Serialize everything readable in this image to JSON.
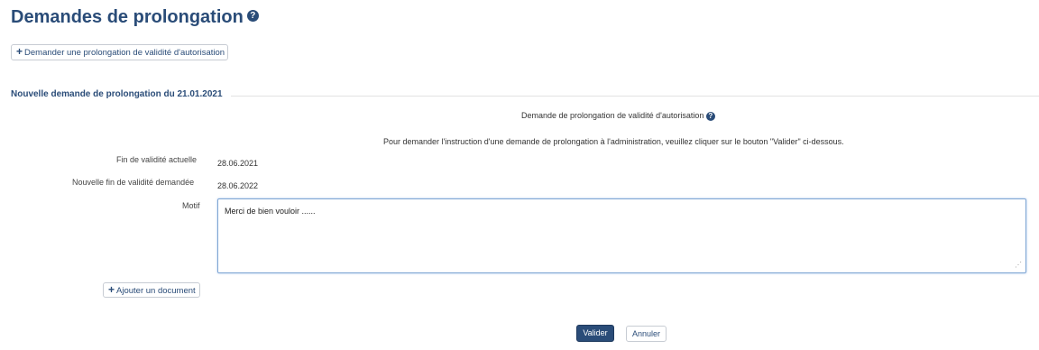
{
  "page": {
    "title": "Demandes de prolongation",
    "help_icon": "question-circle",
    "request_button_label": "Demander une prolongation de validité d'autorisation"
  },
  "section": {
    "title": "Nouvelle demande de prolongation du 21.01.2021",
    "subtitle": "Demande de prolongation de validité d'autorisation",
    "instruction": "Pour demander l'instruction d'une demande de prolongation à l'administration, veuillez cliquer sur le bouton \"Valider\" ci-dessous."
  },
  "form": {
    "current_end_label": "Fin de validité actuelle",
    "current_end_value": "28.06.2021",
    "new_end_label": "Nouvelle fin de validité demandée",
    "new_end_value": "28.06.2022",
    "motif_label": "Motif",
    "motif_value": "Merci de bien vouloir ......",
    "add_document_label": "Ajouter un document"
  },
  "actions": {
    "validate_label": "Valider",
    "cancel_label": "Annuler"
  },
  "colors": {
    "primary": "#2a4c78",
    "border": "#c7ccd3",
    "focus_border": "#7fa6d3"
  }
}
